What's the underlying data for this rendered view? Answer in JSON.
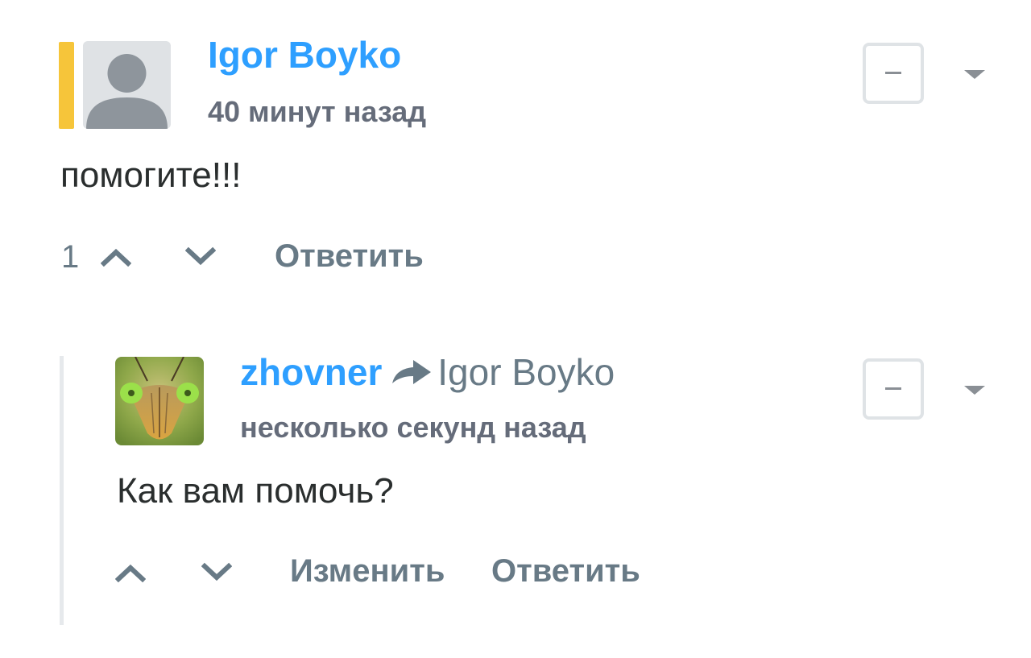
{
  "comments": [
    {
      "author": "Igor Boyko",
      "time": "40 минут назад",
      "text": "помогите!!!",
      "votes": "1",
      "actions": {
        "reply": "Ответить"
      },
      "avatar_icon": "default-avatar-icon",
      "accent_color": "#f6c53a"
    },
    {
      "author": "zhovner",
      "reply_to": "Igor Boyko",
      "time": "несколько секунд назад",
      "text": "Как вам помочь?",
      "actions": {
        "edit": "Изменить",
        "reply": "Ответить"
      },
      "avatar_icon": "mantis-avatar-image"
    }
  ],
  "colors": {
    "link": "#2e9fff",
    "muted": "#687a86",
    "text": "#2a2e2e",
    "thread_line": "#e6e9ec"
  }
}
